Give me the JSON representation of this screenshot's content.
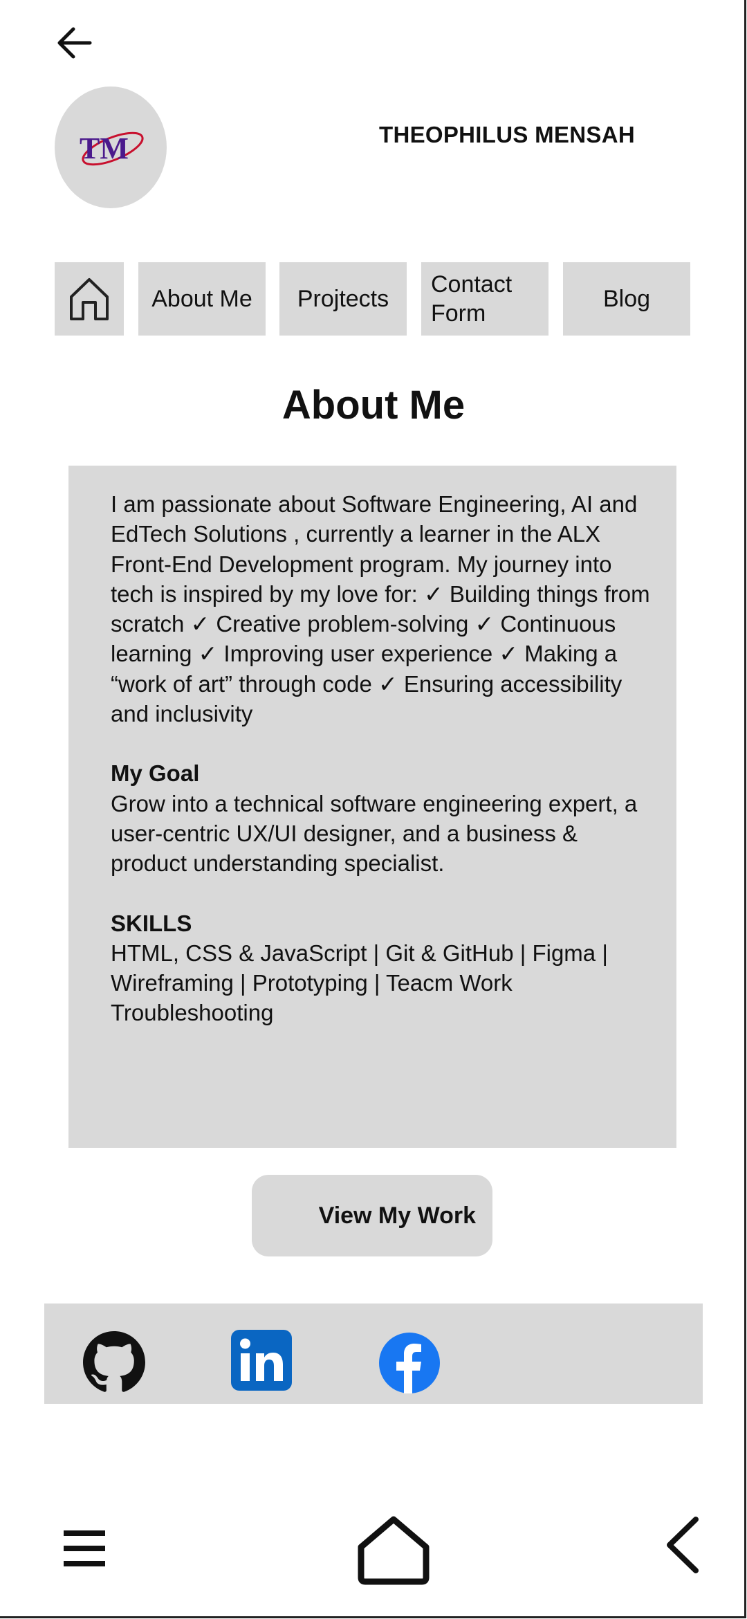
{
  "header": {
    "logo_text": "TM",
    "name": "THEOPHILUS MENSAH"
  },
  "nav": {
    "about": "About Me",
    "projects": "Projtects",
    "contact_line1": "Contact",
    "contact_line2": "Form",
    "blog": "Blog"
  },
  "about": {
    "title": "About Me",
    "intro": "I am passionate about Software Engineering, AI and EdTech Solutions , currently a learner in the ALX Front-End Development program. My journey into tech is inspired by my love for: ✓ Building things from scratch ✓ Creative problem-solving  ✓ Continuous learning ✓ Improving user experience ✓ Making a “work of art” through code ✓ Ensuring accessibility and inclusivity",
    "goal_heading": "My Goal",
    "goal_text": "Grow into a technical software engineering expert, a user-centric UX/UI designer, and a business & product understanding specialist.",
    "skills_heading": "SKILLS",
    "skills_text": "HTML, CSS & JavaScript | Git & GitHub | Figma | Wireframing | Prototyping | Teacm Work Troubleshooting"
  },
  "cta": {
    "label": "View My Work"
  },
  "social": {
    "icons": [
      "github-icon",
      "linkedin-icon",
      "facebook-icon"
    ],
    "linkedin_color": "#0a66c2",
    "facebook_color": "#1877f2"
  },
  "system_nav": {
    "icons": [
      "menu-icon",
      "home-icon",
      "back-icon"
    ]
  }
}
